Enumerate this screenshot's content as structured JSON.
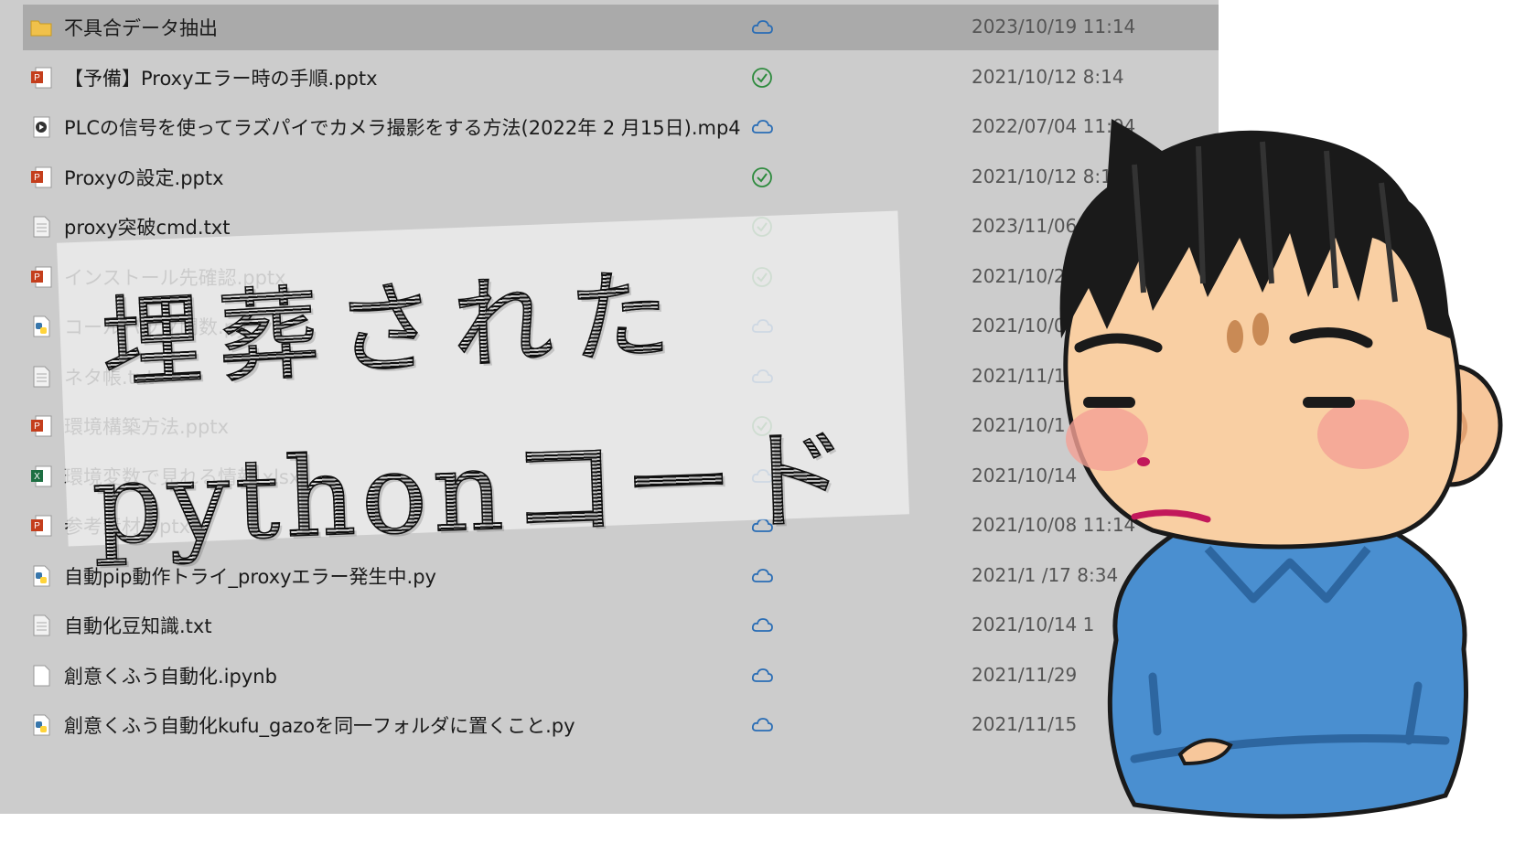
{
  "file_list": {
    "rows": [
      {
        "name": "不具合データ抽出",
        "type": "folder",
        "sync": "cloud",
        "date": "2023/10/19 11:14",
        "selected": true
      },
      {
        "name": "【予備】Proxyエラー時の手順.pptx",
        "type": "pptx",
        "sync": "check",
        "date": "2021/10/12 8:14"
      },
      {
        "name": "PLCの信号を使ってラズパイでカメラ撮影をする方法(2022年 2 月15日).mp4",
        "type": "mp4",
        "sync": "cloud",
        "date": "2022/07/04 11:04"
      },
      {
        "name": "Proxyの設定.pptx",
        "type": "pptx",
        "sync": "check",
        "date": "2021/10/12 8:1"
      },
      {
        "name": "proxy突破cmd.txt",
        "type": "txt",
        "sync": "check",
        "date": "2023/11/06 1"
      },
      {
        "name": "インストール先確認.pptx",
        "type": "pptx",
        "sync": "check",
        "date": "2021/10/25"
      },
      {
        "name": "コールバック関数.py",
        "type": "py",
        "sync": "cloud",
        "date": "2021/10/08"
      },
      {
        "name": "ネタ帳.txt",
        "type": "txt",
        "sync": "cloud",
        "date": "2021/11/1"
      },
      {
        "name": "環境構築方法.pptx",
        "type": "pptx",
        "sync": "check",
        "date": "2021/10/1"
      },
      {
        "name": "環境変数で見れる情報.xlsx",
        "type": "xlsx",
        "sync": "cloud",
        "date": "2021/10/14"
      },
      {
        "name": "参考素材.pptx",
        "type": "pptx",
        "sync": "cloud",
        "date": "2021/10/08 11:14"
      },
      {
        "name": "自動pip動作トライ_proxyエラー発生中.py",
        "type": "py",
        "sync": "cloud",
        "date": "2021/1 /17 8:34"
      },
      {
        "name": "自動化豆知識.txt",
        "type": "txt",
        "sync": "cloud",
        "date": "2021/10/14 1"
      },
      {
        "name": "創意くふう自動化.ipynb",
        "type": "ipynb",
        "sync": "cloud",
        "date": "2021/11/29"
      },
      {
        "name": "創意くふう自動化kufu_gazoを同一フォルダに置くこと.py",
        "type": "py",
        "sync": "cloud",
        "date": "2021/11/15"
      }
    ]
  },
  "overlay": {
    "line1": "埋葬された",
    "line2": "pythonコード"
  },
  "colors": {
    "panel_bg": "#cccccc",
    "selected_bg": "#aaaaaa",
    "pptx": "#c43e1c",
    "xlsx": "#1d6f42",
    "cloud": "#2a6db5",
    "check": "#2e8b3e"
  }
}
